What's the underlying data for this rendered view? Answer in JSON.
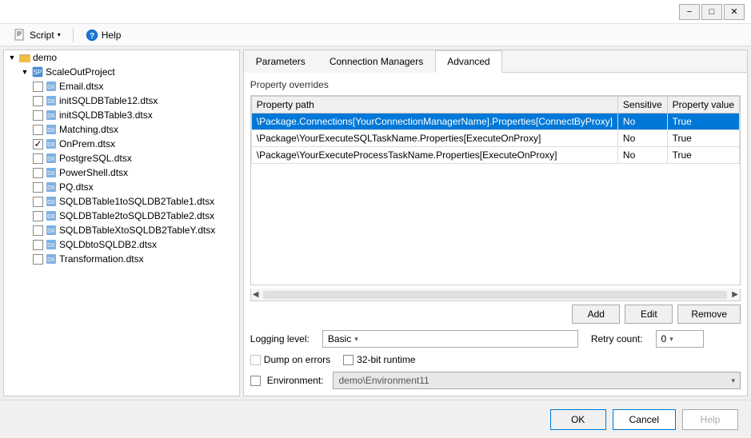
{
  "titlebar": {
    "minimize_label": "−",
    "maximize_label": "□",
    "close_label": "✕"
  },
  "menubar": {
    "script_label": "Script",
    "help_label": "Help"
  },
  "tree": {
    "root_label": "demo",
    "nodes": [
      {
        "id": "root",
        "label": "demo",
        "level": 0,
        "expanded": true,
        "type": "root"
      },
      {
        "id": "scaleout",
        "label": "ScaleOutProject",
        "level": 1,
        "expanded": true,
        "type": "folder",
        "checked": false
      },
      {
        "id": "email",
        "label": "Email.dtsx",
        "level": 2,
        "type": "dtsx",
        "checked": false
      },
      {
        "id": "init12",
        "label": "initSQLDBTable12.dtsx",
        "level": 2,
        "type": "dtsx",
        "checked": false
      },
      {
        "id": "init3",
        "label": "initSQLDBTable3.dtsx",
        "level": 2,
        "type": "dtsx",
        "checked": false
      },
      {
        "id": "matching",
        "label": "Matching.dtsx",
        "level": 2,
        "type": "dtsx",
        "checked": false
      },
      {
        "id": "onprem",
        "label": "OnPrem.dtsx",
        "level": 2,
        "type": "dtsx",
        "checked": true
      },
      {
        "id": "postgres",
        "label": "PostgreSQL.dtsx",
        "level": 2,
        "type": "dtsx",
        "checked": false
      },
      {
        "id": "powershell",
        "label": "PowerShell.dtsx",
        "level": 2,
        "type": "dtsx",
        "checked": false
      },
      {
        "id": "pq",
        "label": "PQ.dtsx",
        "level": 2,
        "type": "dtsx",
        "checked": false
      },
      {
        "id": "sqldb1to1",
        "label": "SQLDBTable1toSQLDB2Table1.dtsx",
        "level": 2,
        "type": "dtsx",
        "checked": false
      },
      {
        "id": "sqldb2to2",
        "label": "SQLDBTable2toSQLDB2Table2.dtsx",
        "level": 2,
        "type": "dtsx",
        "checked": false
      },
      {
        "id": "sqldbxtoY",
        "label": "SQLDBTableXtoSQLDB2TableY.dtsx",
        "level": 2,
        "type": "dtsx",
        "checked": false
      },
      {
        "id": "sqldbtosqldb",
        "label": "SQLDbtoSQLDB2.dtsx",
        "level": 2,
        "type": "dtsx",
        "checked": false
      },
      {
        "id": "transform",
        "label": "Transformation.dtsx",
        "level": 2,
        "type": "dtsx",
        "checked": false
      }
    ]
  },
  "tabs": [
    {
      "id": "parameters",
      "label": "Parameters"
    },
    {
      "id": "connection-managers",
      "label": "Connection Managers"
    },
    {
      "id": "advanced",
      "label": "Advanced"
    }
  ],
  "active_tab": "advanced",
  "advanced": {
    "section_label": "Property overrides",
    "table": {
      "headers": [
        "Property path",
        "Sensitive",
        "Property value"
      ],
      "rows": [
        {
          "path": "\\Package.Connections[YourConnectionManagerName].Properties[ConnectByProxy]",
          "sensitive": "No",
          "value": "True",
          "selected": true
        },
        {
          "path": "\\Package\\YourExecuteSQLTaskName.Properties[ExecuteOnProxy]",
          "sensitive": "No",
          "value": "True",
          "selected": false
        },
        {
          "path": "\\Package\\YourExecuteProcessTaskName.Properties[ExecuteOnProxy]",
          "sensitive": "No",
          "value": "True",
          "selected": false
        }
      ]
    },
    "buttons": {
      "add": "Add",
      "edit": "Edit",
      "remove": "Remove"
    },
    "logging_label": "Logging level:",
    "logging_value": "Basic",
    "retry_label": "Retry count:",
    "retry_value": "0",
    "dump_label": "Dump on errors",
    "runtime_label": "32-bit runtime",
    "environment_label": "Environment:",
    "environment_value": "demo\\Environment11"
  },
  "footer": {
    "ok_label": "OK",
    "cancel_label": "Cancel",
    "help_label": "Help"
  }
}
